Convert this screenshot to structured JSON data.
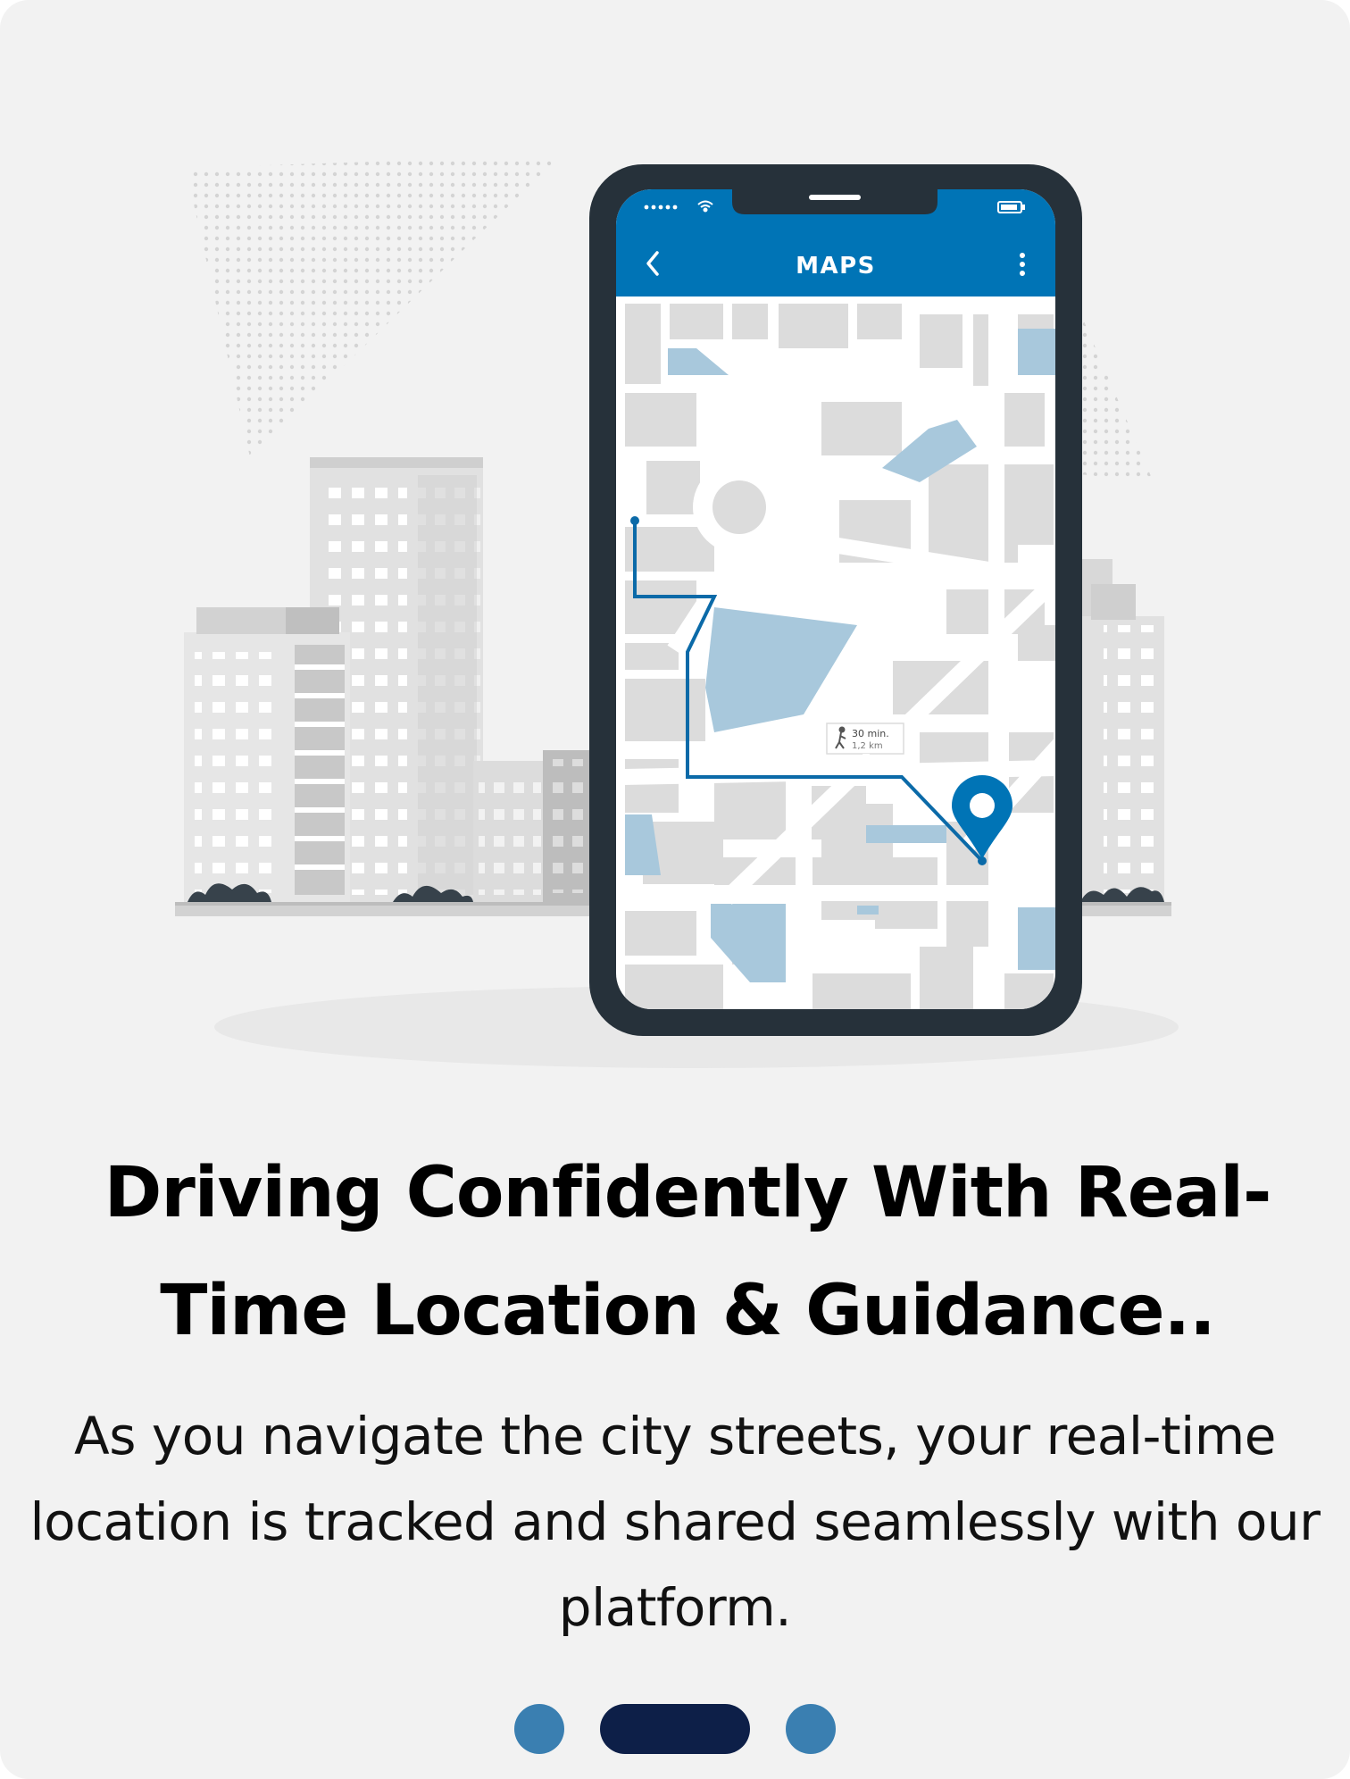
{
  "screen": {
    "headline": "Driving Confidently With Real-Time Location & Guidance..",
    "body": "As you navigate the city streets, your real-time location is tracked and shared seamlessly with our platform."
  },
  "phone": {
    "app_title": "MAPS",
    "back_icon": "chevron-left-icon",
    "menu_icon": "more-vertical-icon",
    "status_signal": "signal-dots-icon",
    "status_wifi": "wifi-icon",
    "status_battery": "battery-icon"
  },
  "map": {
    "eta_time": "30 min.",
    "eta_distance": "1,2 km",
    "eta_icon": "walking-person-icon",
    "destination_icon": "location-pin-icon"
  },
  "pager": {
    "pages": 3,
    "active_page": 2,
    "active_color": "#0d1f48",
    "inactive_color": "#3a7fb1"
  },
  "colors": {
    "app_bar": "#0074b6",
    "phone_frame": "#26313a",
    "route": "#0b6aa8",
    "water": "#a8c8dc",
    "background": "#f2f2f2"
  }
}
